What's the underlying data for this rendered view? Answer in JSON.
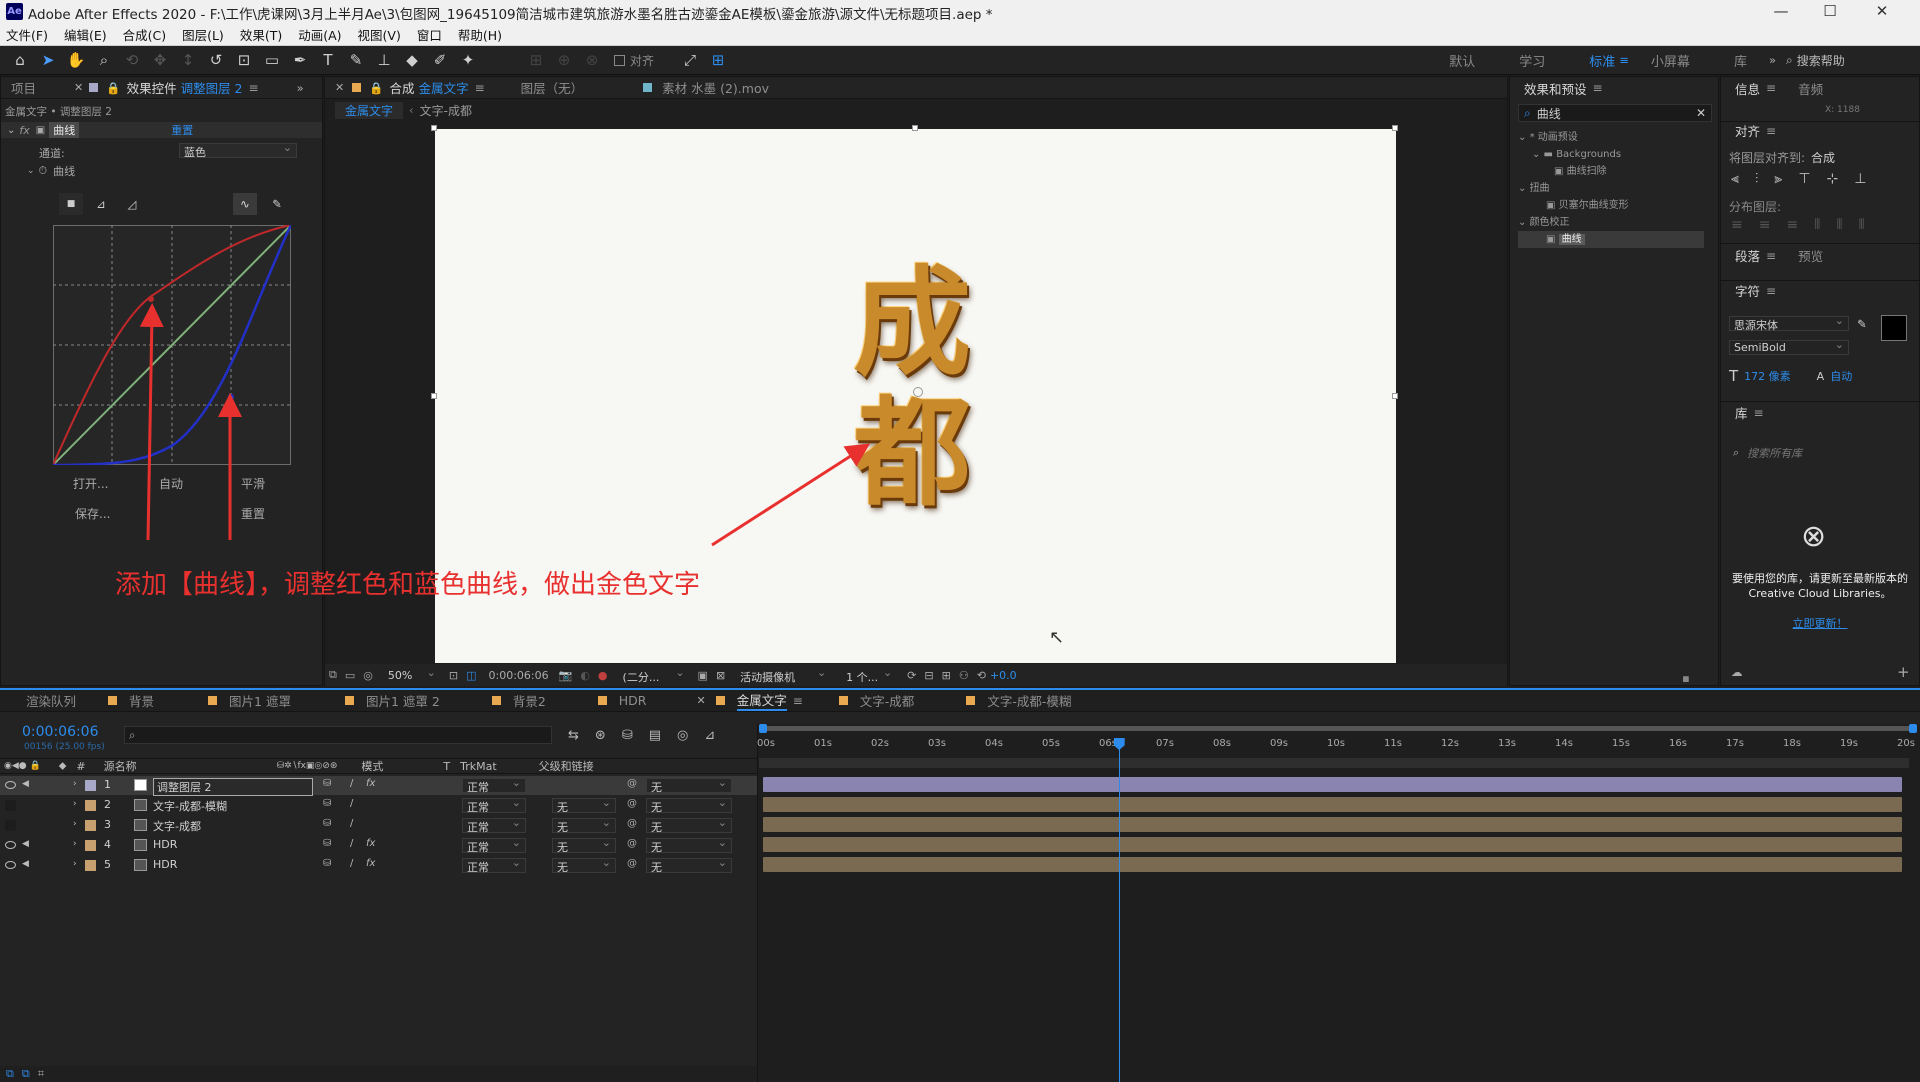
{
  "window": {
    "title": "Adobe After Effects 2020 - F:\\工作\\虎课网\\3月上半月Ae\\3\\包图网_19645109简洁城市建筑旅游水墨名胜古迹鎏金AE模板\\鎏金旅游\\源文件\\无标题项目.aep *",
    "logo": "Ae",
    "min": "—",
    "max": "☐",
    "close": "✕"
  },
  "menu": [
    "文件(F)",
    "编辑(E)",
    "合成(C)",
    "图层(L)",
    "效果(T)",
    "动画(A)",
    "视图(V)",
    "窗口",
    "帮助(H)"
  ],
  "toolbar": {
    "align_label": "对齐",
    "workspaces": [
      "默认",
      "学习",
      "标准",
      "小屏幕",
      "库"
    ],
    "active_workspace": "标准",
    "search_help": "搜索帮助"
  },
  "project_panel": {
    "tab_project": "项目",
    "tab_effect_controls": "效果控件",
    "layer_name": "调整图层 2",
    "breadcrumb": "金属文字 • 调整图层 2",
    "effect_name": "曲线",
    "reset": "重置",
    "channel_label": "通道:",
    "channel_value": "蓝色",
    "curves_label": "曲线",
    "btn_open": "打开...",
    "btn_auto": "自动",
    "btn_smooth": "平滑",
    "btn_save": "保存...",
    "btn_reset": "重置"
  },
  "annotation": {
    "text": "添加【曲线】，调整红色和蓝色曲线，做出金色文字",
    "color": "#e8312f"
  },
  "comp_panel": {
    "tab_comp": "合成",
    "comp_name": "金属文字",
    "layer_tab": "图层（无）",
    "footage_tab": "素材 水墨 (2).mov",
    "sub_tabs": [
      "金属文字",
      "文字-成都"
    ],
    "zoom": "50%",
    "timecode": "0:00:06:06",
    "resolution": "(二分...",
    "camera": "活动摄像机",
    "views": "1 个...",
    "exposure": "+0.0"
  },
  "artwork": {
    "char1": "成",
    "char2": "都"
  },
  "effects_panel": {
    "title": "效果和预设",
    "search": "曲线",
    "tree": [
      "* 动画预设",
      "Backgrounds",
      "曲线扫除",
      "扭曲",
      "贝塞尔曲线变形",
      "颜色校正",
      "曲线"
    ]
  },
  "right_panels": {
    "info": "信息",
    "audio": "音频",
    "align": "对齐",
    "align_to_label": "将图层对齐到:",
    "align_to_value": "合成",
    "distribute": "分布图层:",
    "paragraph": "段落",
    "preview": "预览",
    "character": "字符",
    "font": "思源宋体",
    "font_style": "SemiBold",
    "font_size": "172 像素",
    "leading": "自动",
    "library": "库",
    "lib_search": "搜索所有库",
    "cc_msg1": "要使用您的库，请更新至最新版本的",
    "cc_msg2": "Creative Cloud Libraries。",
    "cc_link": "立即更新！",
    "coord": "X: 1188"
  },
  "timeline": {
    "tabs": [
      "渲染队列",
      "背景",
      "图片1 遮罩",
      "图片1 遮罩 2",
      "背景2",
      "HDR",
      "金属文字",
      "文字-成都",
      "文字-成都-模糊"
    ],
    "active_tab": "金属文字",
    "tab_colors": [
      "#232323",
      "#e8a950",
      "#e8a950",
      "#e8a950",
      "#e8a950",
      "#e8a950",
      "#e8a950",
      "#e8a950",
      "#e8a950"
    ],
    "timecode": "0:00:06:06",
    "fps": "00156 (25.00 fps)",
    "col_source": "源名称",
    "col_mode": "模式",
    "col_t": "T",
    "col_trkmat": "TrkMat",
    "col_parent": "父级和链接",
    "layers": [
      {
        "num": "1",
        "name": "调整图层 2",
        "mode": "正常",
        "trkmat": "",
        "parent": "无",
        "color": "#a8a8c8",
        "fx": true,
        "visible": true,
        "selected": true
      },
      {
        "num": "2",
        "name": "文字-成都-模糊",
        "mode": "正常",
        "trkmat": "无",
        "parent": "无",
        "color": "#c8a070",
        "fx": false,
        "visible": false,
        "selected": false
      },
      {
        "num": "3",
        "name": "文字-成都",
        "mode": "正常",
        "trkmat": "无",
        "parent": "无",
        "color": "#c8a070",
        "fx": false,
        "visible": false,
        "selected": false
      },
      {
        "num": "4",
        "name": "HDR",
        "mode": "正常",
        "trkmat": "无",
        "parent": "无",
        "color": "#c8a070",
        "fx": true,
        "visible": true,
        "selected": false
      },
      {
        "num": "5",
        "name": "HDR",
        "mode": "正常",
        "trkmat": "无",
        "parent": "无",
        "color": "#c8a070",
        "fx": true,
        "visible": true,
        "selected": false
      }
    ],
    "ruler": [
      "00s",
      "01s",
      "02s",
      "03s",
      "04s",
      "05s",
      "06s",
      "07s",
      "08s",
      "09s",
      "10s",
      "11s",
      "12s",
      "13s",
      "14s",
      "15s",
      "16s",
      "17s",
      "18s",
      "19s",
      "20s"
    ],
    "playhead_seconds": 6.24
  }
}
